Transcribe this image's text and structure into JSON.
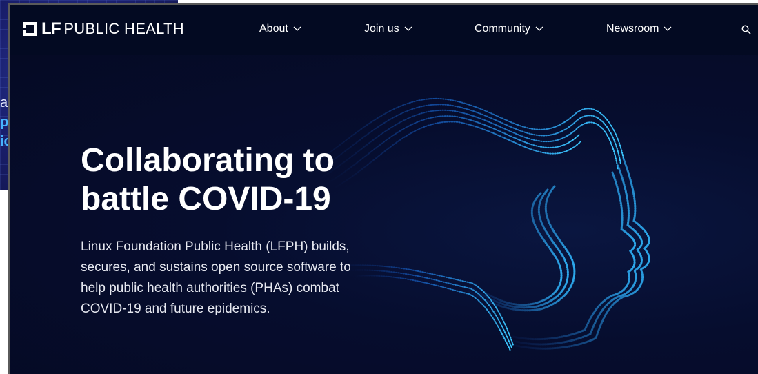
{
  "background_window": {
    "fragment_1": "ati",
    "fragment_2": "p",
    "fragment_3": "ic"
  },
  "brand": {
    "mark": "LF",
    "name": "PUBLIC HEALTH"
  },
  "nav": {
    "items": [
      {
        "label": "About"
      },
      {
        "label": "Join us"
      },
      {
        "label": "Community"
      },
      {
        "label": "Newsroom"
      }
    ],
    "search_icon": "search-icon"
  },
  "hero": {
    "headline": "Collaborating to\nbattle COVID-19",
    "description": "Linux Foundation Public Health (LFPH) builds, secures, and sustains open source software to help public health authorities (PHAs) combat COVID-19 and future epidemics."
  },
  "colors": {
    "page_bg": "#050b28",
    "nav_bg": "#030a22",
    "accent": "#1fa3ff",
    "text": "#ffffff"
  }
}
